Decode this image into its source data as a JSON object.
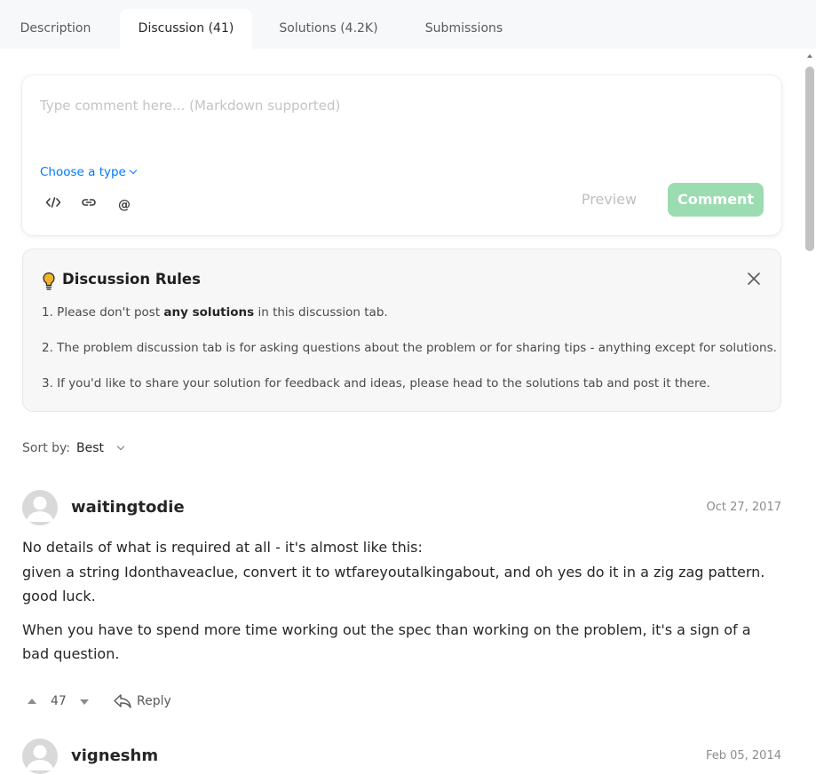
{
  "tabs": [
    {
      "label": "Description",
      "active": false
    },
    {
      "label": "Discussion (41)",
      "active": true
    },
    {
      "label": "Solutions (4.2K)",
      "active": false
    },
    {
      "label": "Submissions",
      "active": false
    }
  ],
  "composer": {
    "placeholder": "Type comment here... (Markdown supported)",
    "choose_type": "Choose a type",
    "tools": [
      "code-icon",
      "link-icon",
      "mention-icon"
    ],
    "preview_label": "Preview",
    "comment_label": "Comment"
  },
  "rules": {
    "title": "Discussion Rules",
    "line1_prefix": "1. Please don't post ",
    "line1_bold": "any solutions",
    "line1_suffix": " in this discussion tab.",
    "line2": "2. The problem discussion tab is for asking questions about the problem or for sharing tips - anything except for solutions.",
    "line3": "3. If you'd like to share your solution for feedback and ideas, please head to the solutions tab and post it there."
  },
  "sort": {
    "label": "Sort by:",
    "value": "Best"
  },
  "posts": [
    {
      "author": "waitingtodie",
      "date": "Oct 27, 2017",
      "paragraphs": [
        "No details of what is required at all - it's almost like this:",
        "given a string Idonthaveaclue, convert it to wtfareyoutalkingabout, and oh yes do it in a zig zag pattern. good luck.",
        "When you have to spend more time working out the spec than working on the problem, it's a sign of a bad question."
      ],
      "votes": "47",
      "reply_label": "Reply"
    },
    {
      "author": "vigneshm",
      "date": "Feb 05, 2014"
    }
  ],
  "colors": {
    "accent": "#007aff",
    "comment_button": "#9cdcb1",
    "rules_bg": "#f7f7f8",
    "bulb": "#f0b429"
  }
}
